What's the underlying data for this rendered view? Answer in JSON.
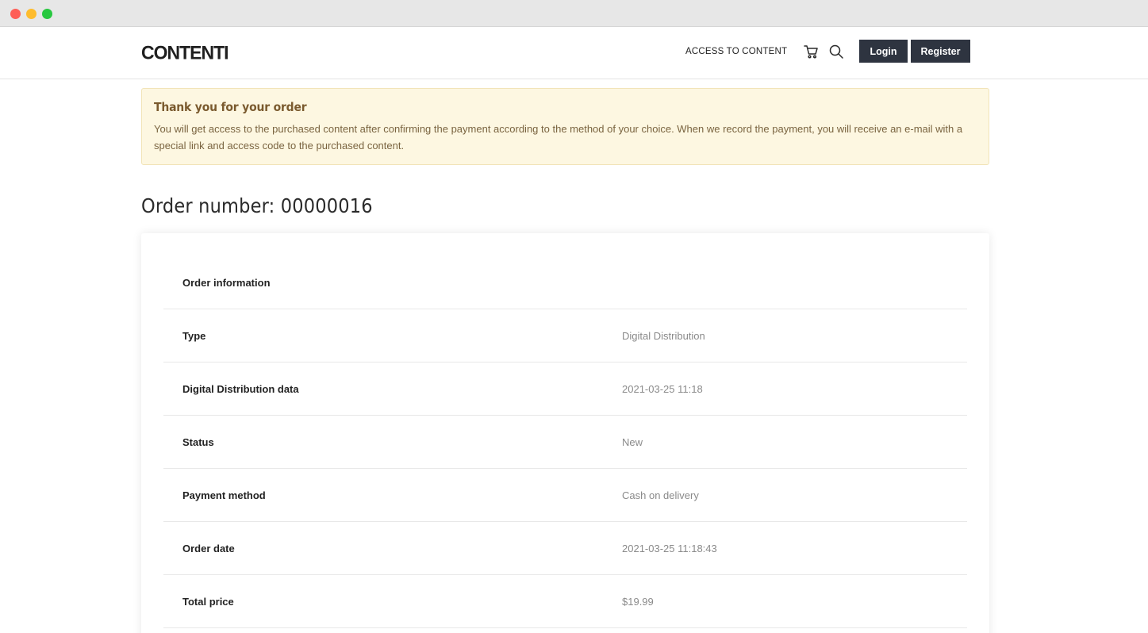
{
  "header": {
    "logo": "CONTENTI",
    "nav_link": "ACCESS TO CONTENT",
    "login_label": "Login",
    "register_label": "Register",
    "cart_icon": "cart-icon",
    "search_icon": "search-icon"
  },
  "notice": {
    "title": "Thank you for your order",
    "text": "You will get access to the purchased content after confirming the payment according to the method of your choice. When we record the payment, you will receive an e-mail with a special link and access code to the purchased content."
  },
  "order": {
    "heading_label": "Order number:",
    "number": "00000016"
  },
  "details": {
    "section_title": "Order information",
    "rows": [
      {
        "label": "Type",
        "value": "Digital Distribution"
      },
      {
        "label": "Digital Distribution data",
        "value": "2021-03-25 11:18"
      },
      {
        "label": "Status",
        "value": "New"
      },
      {
        "label": "Payment method",
        "value": "Cash on delivery"
      },
      {
        "label": "Order date",
        "value": "2021-03-25 11:18:43"
      },
      {
        "label": "Total price",
        "value": "$19.99"
      }
    ]
  },
  "colors": {
    "button_bg": "#2e3440",
    "notice_bg": "#fdf7e1",
    "notice_title": "#7a5a2e"
  }
}
